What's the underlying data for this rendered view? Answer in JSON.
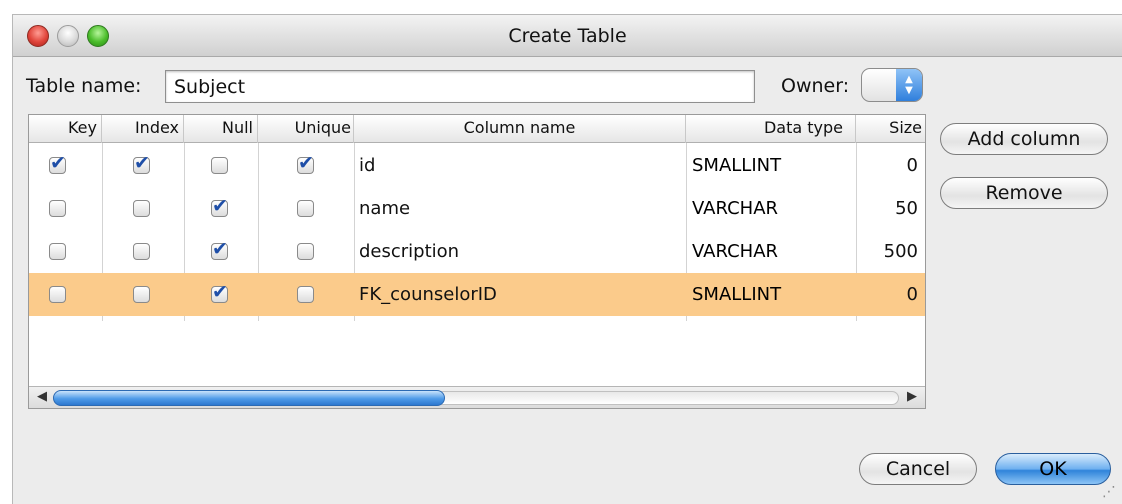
{
  "window": {
    "title": "Create Table"
  },
  "form": {
    "table_name_label": "Table name:",
    "table_name_value": "Subject",
    "owner_label": "Owner:"
  },
  "table": {
    "headers": [
      "Key",
      "Index",
      "Null",
      "Unique",
      "Column name",
      "Data type",
      "Size"
    ],
    "rows": [
      {
        "key": true,
        "index": true,
        "null": false,
        "unique": true,
        "name": "id",
        "type": "SMALLINT",
        "size": "0"
      },
      {
        "key": false,
        "index": false,
        "null": true,
        "unique": false,
        "name": "name",
        "type": "VARCHAR",
        "size": "50"
      },
      {
        "key": false,
        "index": false,
        "null": true,
        "unique": false,
        "name": "description",
        "type": "VARCHAR",
        "size": "500"
      },
      {
        "key": false,
        "index": false,
        "null": true,
        "unique": false,
        "name": "FK_counselorID",
        "type": "SMALLINT",
        "size": "0"
      }
    ],
    "selected_row": 3
  },
  "buttons": {
    "add_column": "Add column",
    "remove": "Remove",
    "cancel": "Cancel",
    "ok": "OK"
  },
  "colors": {
    "selection": "#fbcb8b",
    "accent": "#2f83da"
  },
  "icons": [
    "close-icon",
    "minimize-icon",
    "zoom-icon",
    "up-down-arrows-icon",
    "scroll-left-icon",
    "scroll-right-icon",
    "resize-grip-icon"
  ]
}
